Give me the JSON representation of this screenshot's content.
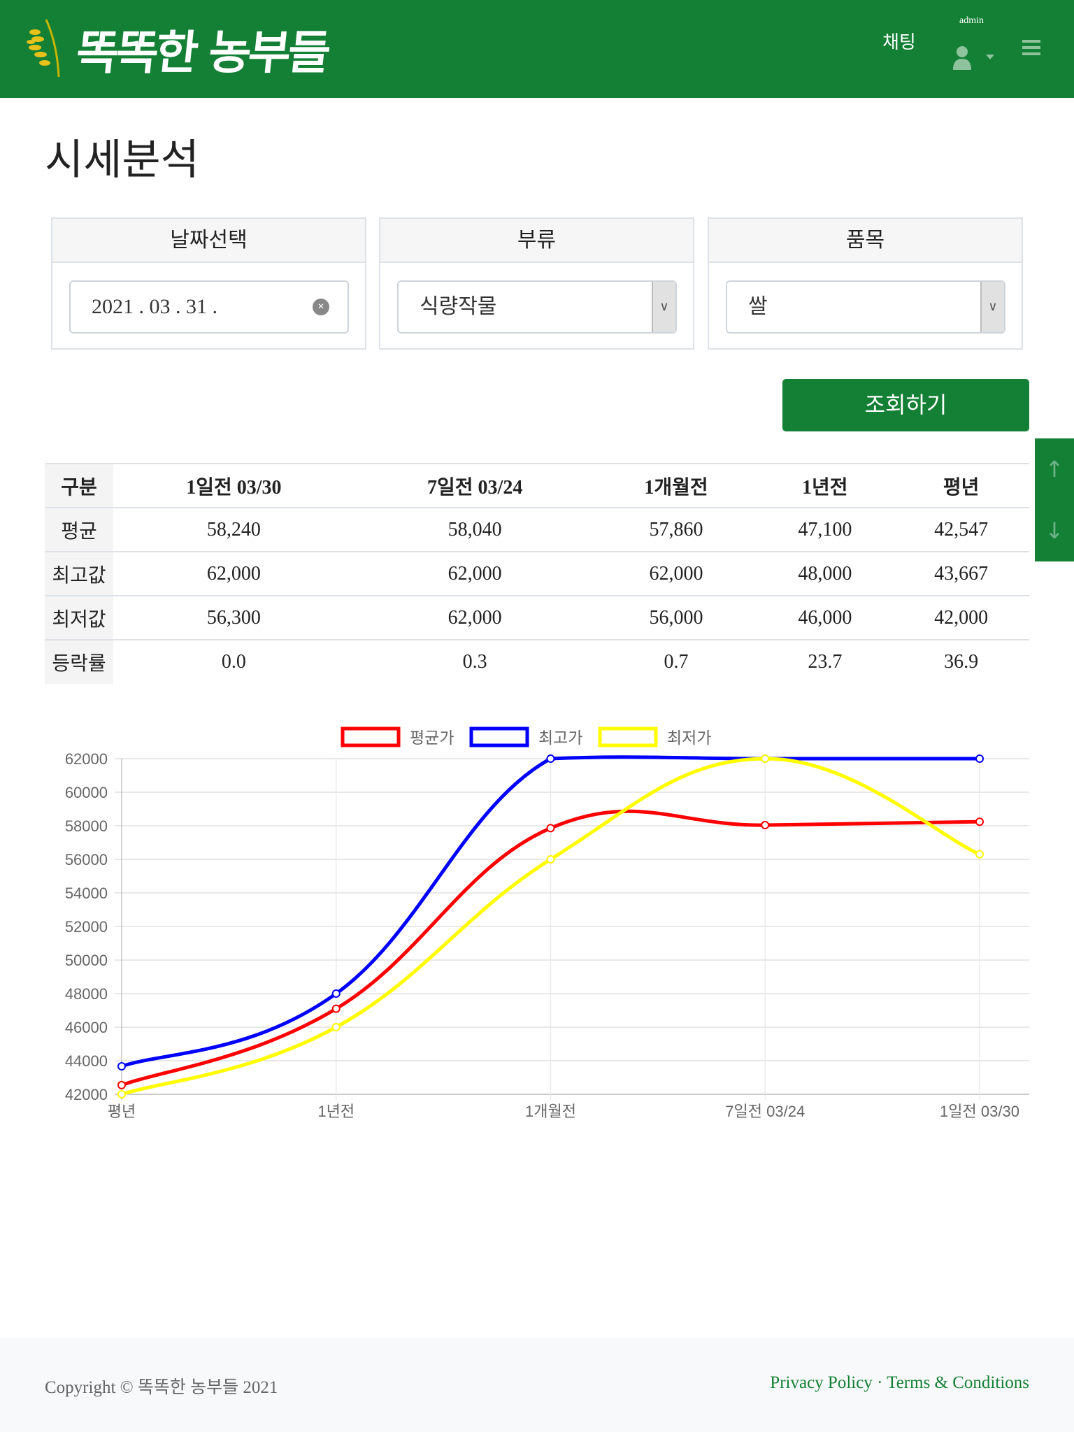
{
  "header": {
    "logo_text": "똑똑한 농부들",
    "chat": "채팅",
    "user": "admin"
  },
  "page_title": "시세분석",
  "filters": {
    "date": {
      "label": "날짜선택",
      "value": "2021 .  03 .  31 ."
    },
    "category": {
      "label": "부류",
      "value": "식량작물"
    },
    "item": {
      "label": "품목",
      "value": "쌀"
    }
  },
  "search_button": "조회하기",
  "table": {
    "headers": [
      "구분",
      "1일전 03/30",
      "7일전 03/24",
      "1개월전",
      "1년전",
      "평년"
    ],
    "rows": [
      [
        "평균",
        "58,240",
        "58,040",
        "57,860",
        "47,100",
        "42,547"
      ],
      [
        "최고값",
        "62,000",
        "62,000",
        "62,000",
        "48,000",
        "43,667"
      ],
      [
        "최저값",
        "56,300",
        "62,000",
        "56,000",
        "46,000",
        "42,000"
      ],
      [
        "등락률",
        "0.0",
        "0.3",
        "0.7",
        "23.7",
        "36.9"
      ]
    ]
  },
  "chart_data": {
    "type": "line",
    "categories": [
      "평년",
      "1년전",
      "1개월전",
      "7일전 03/24",
      "1일전 03/30"
    ],
    "series": [
      {
        "name": "평균가",
        "color": "#ff0000",
        "values": [
          42547,
          47100,
          57860,
          58040,
          58240
        ]
      },
      {
        "name": "최고가",
        "color": "#0000ff",
        "values": [
          43667,
          48000,
          62000,
          62000,
          62000
        ]
      },
      {
        "name": "최저가",
        "color": "#ffff00",
        "values": [
          42000,
          46000,
          56000,
          62000,
          56300
        ]
      }
    ],
    "ylim": [
      42000,
      62000
    ],
    "yticks": [
      "62000",
      "60000",
      "58000",
      "56000",
      "54000",
      "52000",
      "50000",
      "48000",
      "46000",
      "44000",
      "42000"
    ],
    "grid": true,
    "legend": "top"
  },
  "footer": {
    "copyright": "Copyright © 똑똑한 농부들 2021",
    "privacy": "Privacy Policy",
    "sep": " · ",
    "terms": "Terms & Conditions"
  }
}
